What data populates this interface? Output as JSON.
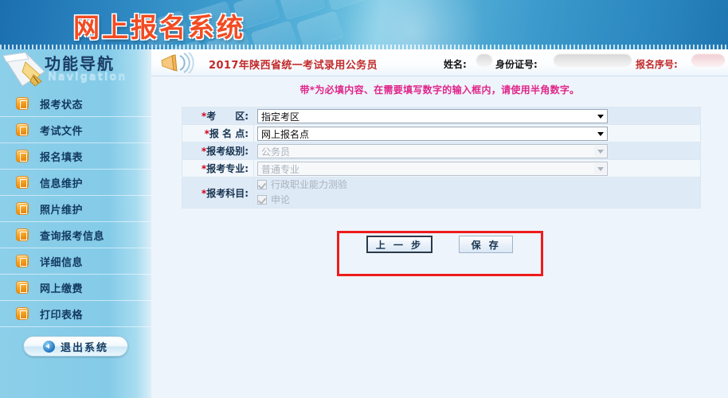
{
  "banner": {
    "title": "网上报名系统",
    "title_color": "#f24b22",
    "pen_icon": "pen-icon",
    "keyboard_watermark": "keyboard-watermark-icon"
  },
  "sidebar": {
    "title": "功能导航",
    "subtitle": "Navigation",
    "bg_color": "#84cbe8",
    "items": [
      {
        "label": "报考状态",
        "icon": "bullet-icon"
      },
      {
        "label": "考试文件",
        "icon": "bullet-icon"
      },
      {
        "label": "报名填表",
        "icon": "bullet-icon"
      },
      {
        "label": "信息维护",
        "icon": "bullet-icon"
      },
      {
        "label": "照片维护",
        "icon": "bullet-icon"
      },
      {
        "label": "查询报考信息",
        "icon": "bullet-icon"
      },
      {
        "label": "详细信息",
        "icon": "bullet-icon"
      },
      {
        "label": "网上缴费",
        "icon": "bullet-icon"
      },
      {
        "label": "打印表格",
        "icon": "bullet-icon"
      }
    ],
    "logout": {
      "label": "退出系统",
      "icon": "back-arrow-icon"
    }
  },
  "header": {
    "icon": "megaphone-icon",
    "title": "2017年陕西省统一考试录用公务员",
    "title_color": "#c22a2a",
    "fields": [
      {
        "label": "姓名:",
        "value": "",
        "redacted": true
      },
      {
        "label": "身份证号:",
        "value": "",
        "redacted": true
      },
      {
        "label": "报名序号:",
        "value": "",
        "redacted": true,
        "color": "#c22a2a"
      }
    ]
  },
  "notice": {
    "text": "带*为必填内容、在需要填写数字的输入框内，请使用半角数字。",
    "color": "#e0268a"
  },
  "form": {
    "rows": [
      {
        "required": "*",
        "label": "考　　区:",
        "type": "select",
        "value": "指定考区",
        "disabled": false
      },
      {
        "required": "*",
        "label": "报 名 点:",
        "type": "select",
        "value": "网上报名点",
        "disabled": false
      },
      {
        "required": "*",
        "label": "报考级别:",
        "type": "select",
        "value": "公务员",
        "disabled": true
      },
      {
        "required": "*",
        "label": "报考专业:",
        "type": "select",
        "value": "普通专业",
        "disabled": true
      }
    ],
    "subject_row": {
      "required": "*",
      "label": "报考科目:",
      "checkboxes": [
        {
          "label": "行政职业能力测验",
          "checked": true,
          "disabled": true
        },
        {
          "label": "申论",
          "checked": true,
          "disabled": true
        }
      ]
    }
  },
  "annotation": {
    "name": "red-highlight-box",
    "color": "#ee1c1c"
  },
  "buttons": {
    "prev": {
      "label": "上 一 步",
      "focused": true
    },
    "save": {
      "label": "保 存",
      "focused": false
    }
  }
}
